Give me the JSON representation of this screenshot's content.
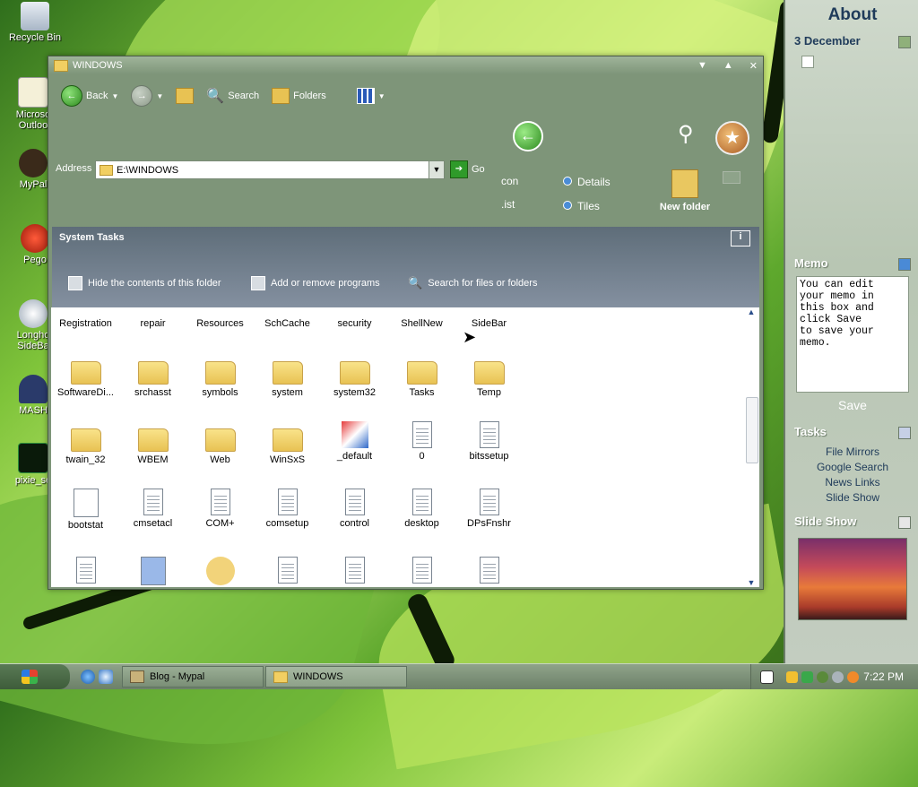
{
  "desktop": {
    "icons": [
      {
        "label": "Recycle Bin"
      },
      {
        "label": "Microso\nOutloo"
      },
      {
        "label": "MyPal"
      },
      {
        "label": "Pego"
      },
      {
        "label": "Longho\nSideBa"
      },
      {
        "label": "MASH"
      },
      {
        "label": "pixie_se"
      }
    ]
  },
  "window": {
    "title": "WINDOWS",
    "controls": [
      "▼",
      "▲",
      "✕"
    ],
    "toolbar": {
      "back": "Back",
      "search": "Search",
      "folders": "Folders"
    },
    "address": {
      "label": "Address",
      "value": "E:\\WINDOWS",
      "go": "Go"
    },
    "view": {
      "icons": "con",
      "list": ".ist",
      "details": "Details",
      "tiles": "Tiles",
      "new_folder": "New folder"
    },
    "system_tasks": {
      "title": "System Tasks",
      "info": "i",
      "links": [
        "Hide the contents of this folder",
        "Add or remove programs",
        "Search for files or folders"
      ]
    },
    "files": {
      "row1": [
        "Registration",
        "repair",
        "Resources",
        "SchCache",
        "security",
        "ShellNew",
        "SideBar"
      ],
      "row2": [
        "SoftwareDi...",
        "srchasst",
        "symbols",
        "system",
        "system32",
        "Tasks",
        "Temp"
      ],
      "row3": [
        "twain_32",
        "WBEM",
        "Web",
        "WinSxS",
        "_default",
        "0",
        "bitssetup"
      ],
      "row4": [
        "bootstat",
        "cmsetacl",
        "COM+",
        "comsetup",
        "control",
        "desktop",
        "DPsFnshr"
      ]
    }
  },
  "sidebar": {
    "title": "About",
    "date": "3 December",
    "memo": {
      "title": "Memo",
      "text": "You can edit\nyour memo in\nthis box and\nclick Save\nto save your\nmemo.",
      "save": "Save"
    },
    "tasks": {
      "title": "Tasks",
      "links": [
        "File Mirrors",
        "Google Search",
        "News Links",
        "Slide Show"
      ]
    },
    "slideshow": {
      "title": "Slide Show"
    }
  },
  "taskbar": {
    "buttons": [
      "Blog - Mypal",
      "WINDOWS"
    ],
    "clock": "7:22 PM"
  },
  "colors": {
    "window_bg": "#7e9579",
    "tasks_band": "#5e6d79",
    "sidebar_bg": "#cfd9cc",
    "taskbar_bg": "#8fa38a"
  }
}
